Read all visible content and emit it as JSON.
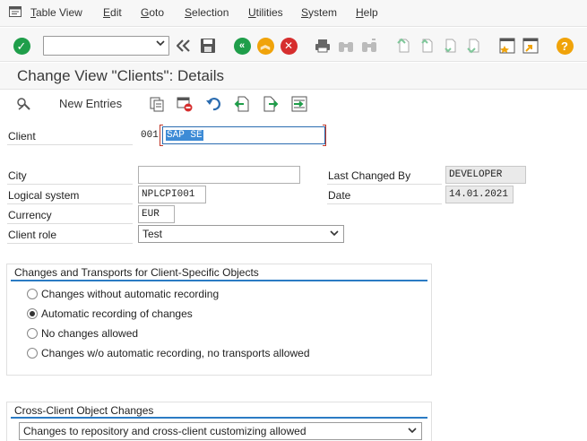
{
  "menu": {
    "items": [
      "Table View",
      "Edit",
      "Goto",
      "Selection",
      "Utilities",
      "System",
      "Help"
    ]
  },
  "toolbar": {
    "command_value": "",
    "help_glyph": "?"
  },
  "header": {
    "title": "Change View \"Clients\": Details"
  },
  "app_toolbar": {
    "new_entries": "New Entries"
  },
  "form": {
    "client_label": "Client",
    "client_number": "001",
    "client_name": "SAP SE",
    "city_label": "City",
    "city_value": "",
    "logical_system_label": "Logical system",
    "logical_system_value": "NPLCPI001",
    "currency_label": "Currency",
    "currency_value": "EUR",
    "client_role_label": "Client role",
    "client_role_value": "Test",
    "last_changed_by_label": "Last Changed By",
    "last_changed_by_value": "DEVELOPER",
    "date_label": "Date",
    "date_value": "14.01.2021"
  },
  "changes_transports": {
    "title": "Changes and Transports for Client-Specific Objects",
    "options": [
      {
        "label": "Changes without automatic recording",
        "selected": false
      },
      {
        "label": "Automatic recording of changes",
        "selected": true
      },
      {
        "label": "No changes allowed",
        "selected": false
      },
      {
        "label": "Changes w/o automatic recording, no transports allowed",
        "selected": false
      }
    ]
  },
  "cross_client": {
    "title": "Cross-Client Object Changes",
    "selected_value": "Changes to repository and cross-client customizing allowed"
  },
  "colors": {
    "accent_blue": "#2b7bc4",
    "green_action": "#1f9e4a",
    "orange_action": "#f0a30a",
    "red_action": "#d62e2e",
    "selection_blue": "#3d8bd6"
  }
}
